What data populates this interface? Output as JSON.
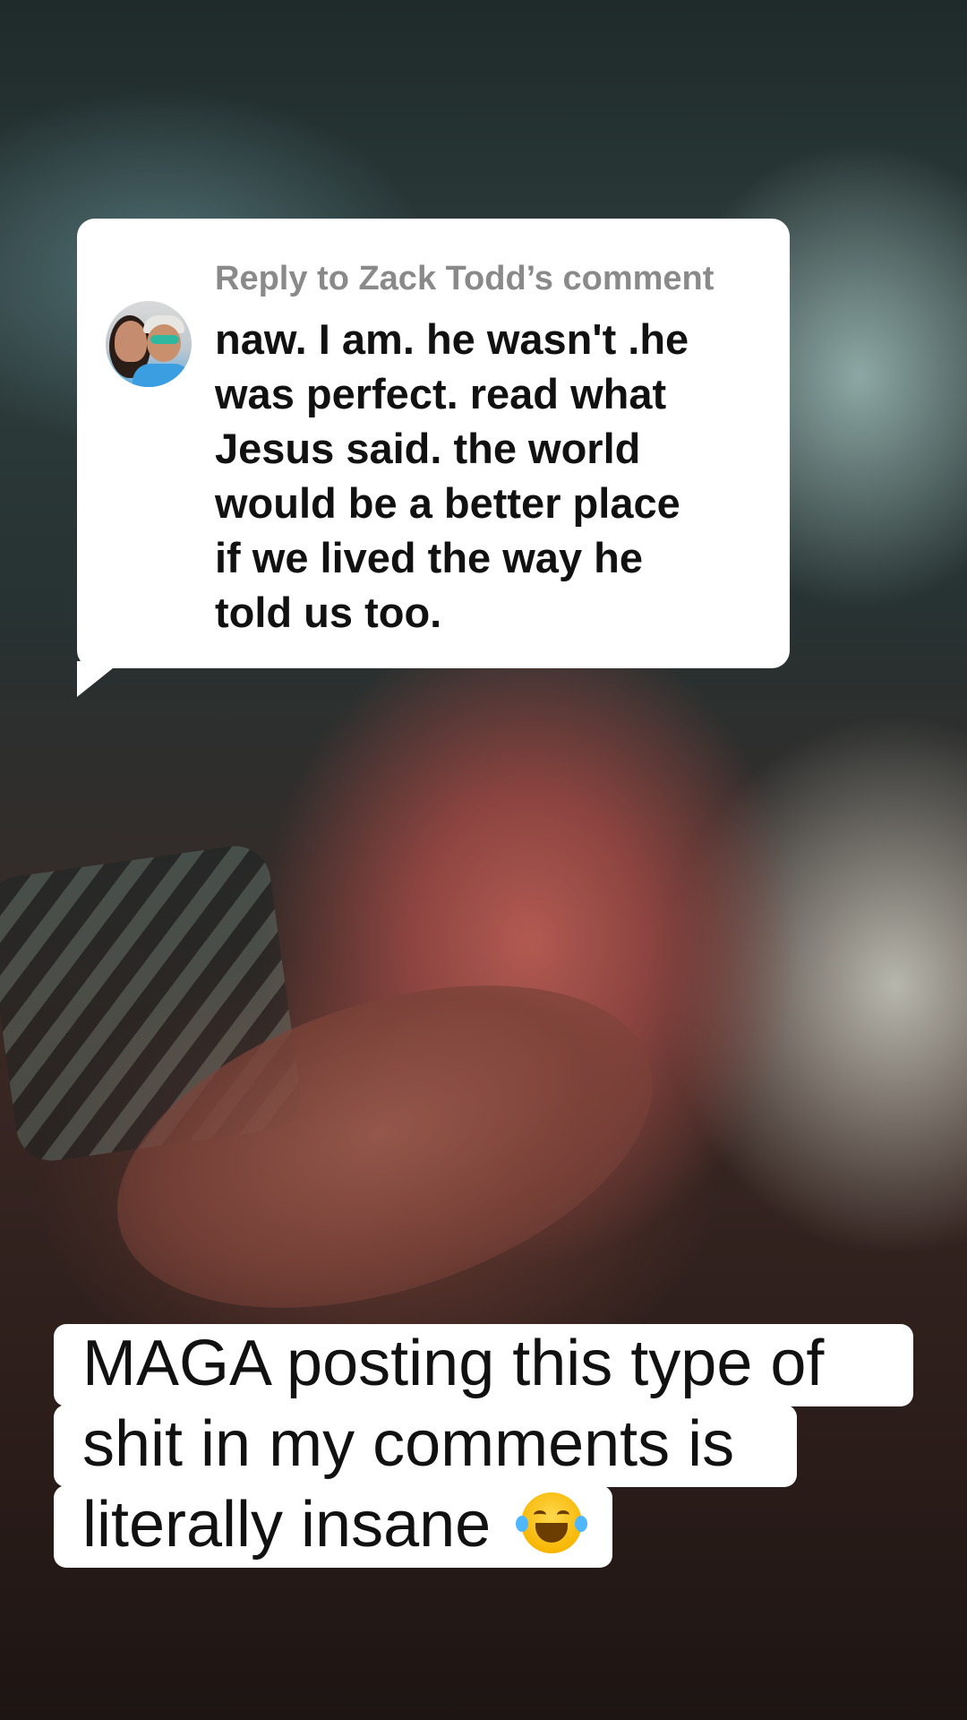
{
  "reply": {
    "label": "Reply to Zack Todd’s comment",
    "body": "naw. I am. he wasn't .he\nwas perfect. read what\nJesus said. the world\nwould be a better place\nif we lived the way he\ntold us too."
  },
  "caption": {
    "line1": "MAGA posting this type of",
    "line2": "shit in my comments is",
    "line3": "literally insane",
    "emoji": "face-with-tears-of-joy-icon"
  },
  "colors": {
    "card_bg": "#ffffff",
    "reply_label": "#8a8a8a",
    "text": "#111111"
  }
}
